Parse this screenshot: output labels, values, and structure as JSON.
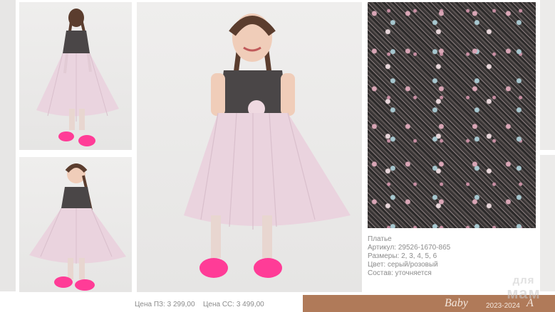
{
  "product": {
    "name": "Платье",
    "article": "Артикул: 29526-1670-865",
    "sizes": "Размеры: 2, 3, 4, 5, 6",
    "color": "Цвет: серый/розовый",
    "composition": "Состав: уточняется"
  },
  "prices": {
    "p3": "Цена ПЗ: 3 299,00",
    "cc": "Цена СС: 3 499,00"
  },
  "footer": {
    "brand": "Baby",
    "season": "2023-2024",
    "brand_cut": "A"
  },
  "watermark": {
    "line1": "для",
    "line2": "мам"
  },
  "colors": {
    "band": "#b07a59",
    "dress_top": "#3f3b3c",
    "tulle": "#e9cfdb",
    "sneakers": "#ff3c97"
  }
}
